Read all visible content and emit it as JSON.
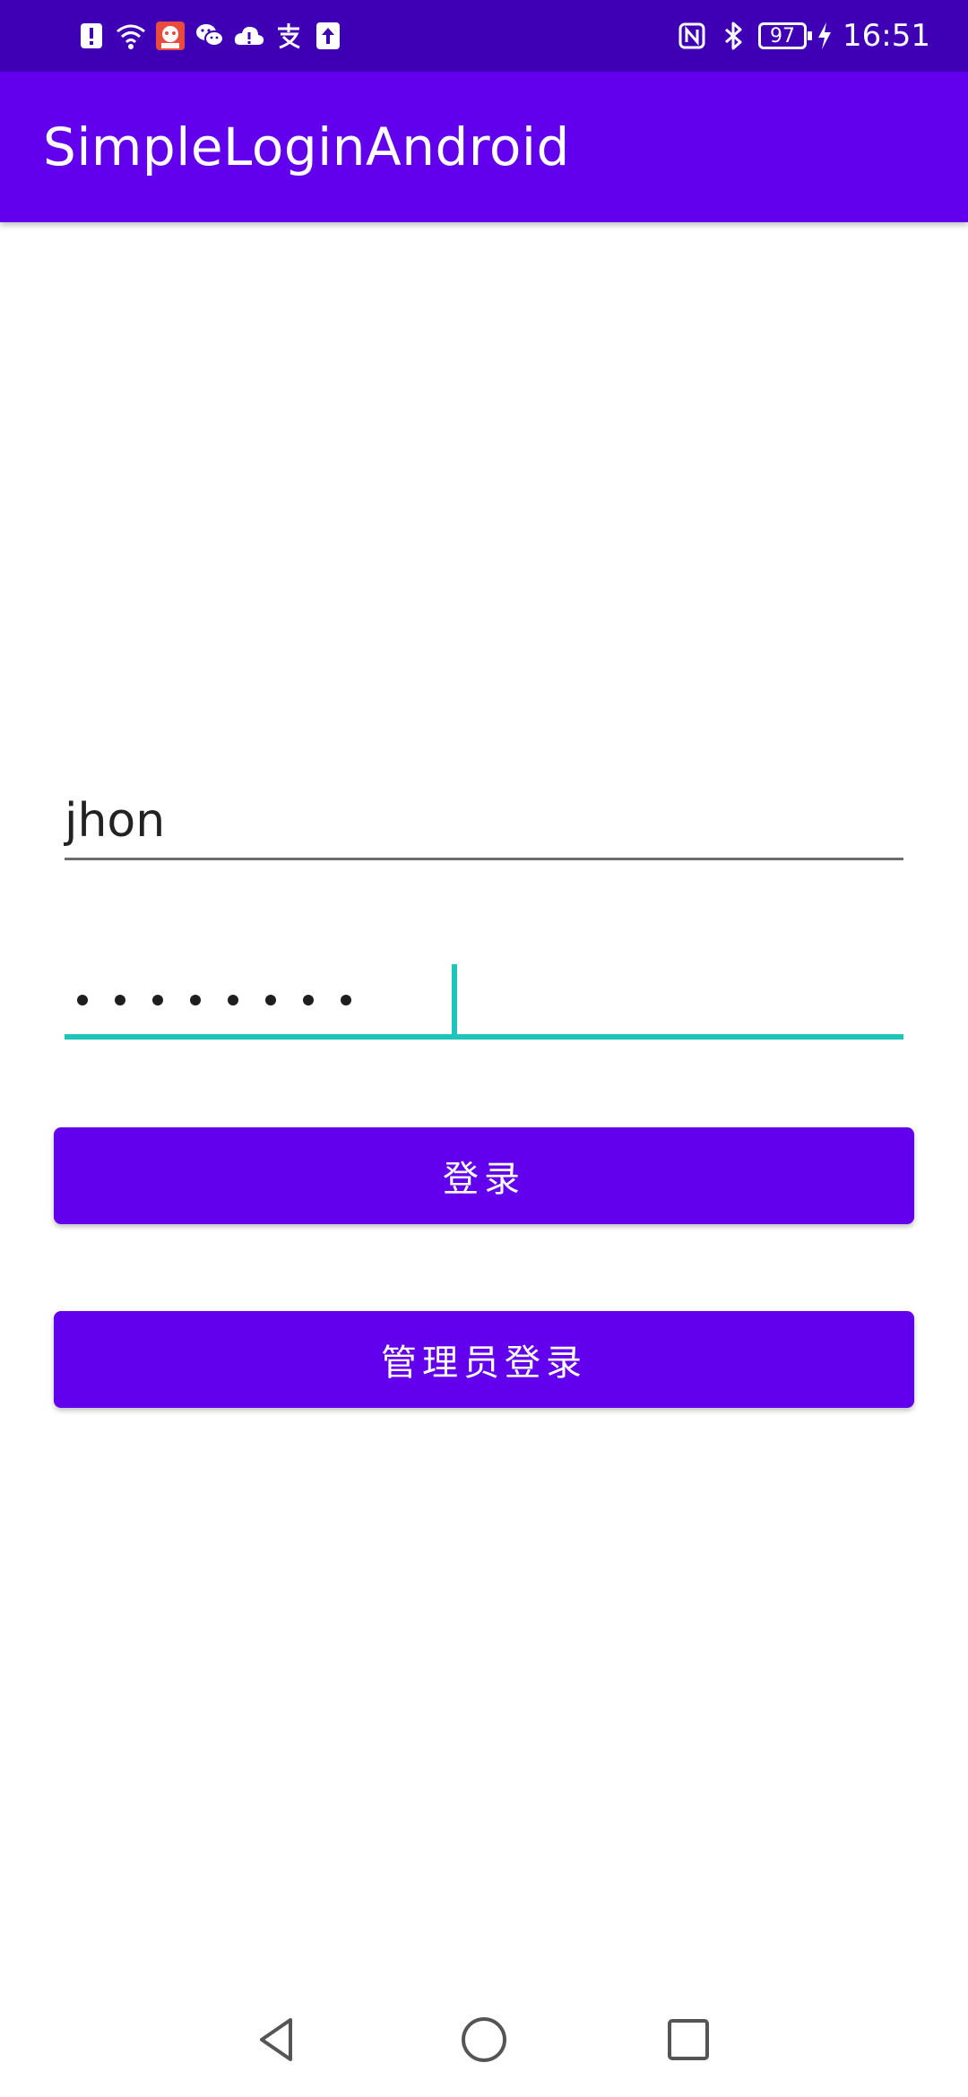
{
  "status_bar": {
    "left_icons": [
      "alert-icon",
      "wifi-icon",
      "app-notification-icon",
      "wechat-icon",
      "cloud-alert-icon",
      "alipay-icon",
      "upload-icon"
    ],
    "right_icons": [
      "nfc-icon",
      "bluetooth-icon",
      "battery-icon",
      "charging-icon"
    ],
    "battery_level": "97",
    "time": "16:51"
  },
  "app_bar": {
    "title": "SimpleLoginAndroid"
  },
  "form": {
    "username_value": "jhon",
    "password_masked_length": 8,
    "login_button_label": "登录",
    "admin_login_button_label": "管理员登录"
  },
  "nav_bar": {
    "icons": [
      "back-icon",
      "home-icon",
      "recent-apps-icon"
    ]
  },
  "colors": {
    "status_bar": "#3F00B5",
    "primary": "#6200EE",
    "accent": "#1FC5BA",
    "text": "#222222",
    "background": "#FFFFFF"
  }
}
